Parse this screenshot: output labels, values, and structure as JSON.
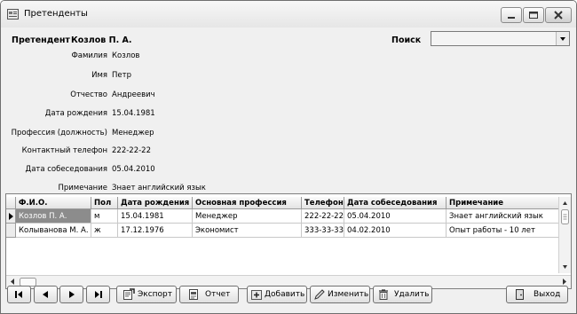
{
  "window": {
    "title": "Претенденты"
  },
  "header": {
    "label": "Претендент",
    "name": "Козлов П. А.",
    "search_label": "Поиск",
    "search_value": ""
  },
  "fields": [
    {
      "label": "Фамилия",
      "value": "Козлов"
    },
    {
      "label": "Имя",
      "value": "Петр"
    },
    {
      "label": "Отчество",
      "value": "Андреевич"
    },
    {
      "label": "Дата рождения",
      "value": "15.04.1981"
    },
    {
      "label": "Профессия (должность)",
      "value": "Менеджер"
    },
    {
      "label": "Контактный телефон",
      "value": "222-22-22"
    },
    {
      "label": "Дата собеседования",
      "value": "05.04.2010"
    },
    {
      "label": "Примечание",
      "value": "Знает английский язык"
    }
  ],
  "grid": {
    "columns": [
      "Ф.И.О.",
      "Пол",
      "Дата рождения",
      "Основная профессия",
      "Телефон",
      "Дата собеседования",
      "Примечание"
    ],
    "rows": [
      [
        "Козлов П. А.",
        "м",
        "15.04.1981",
        "Менеджер",
        "222-22-22",
        "05.04.2010",
        "Знает английский язык"
      ],
      [
        "Колыванова М. А.",
        "ж",
        "17.12.1976",
        "Экономист",
        "333-33-33",
        "04.02.2010",
        "Опыт работы - 10 лет"
      ]
    ],
    "selected_row": 0
  },
  "toolbar": {
    "export_label": "Экспорт",
    "report_label": "Отчет",
    "add_label": "Добавить",
    "edit_label": "Изменить",
    "delete_label": "Удалить",
    "exit_label": "Выход"
  },
  "colors": {
    "selection": "#8c8c8c",
    "window_bg": "#f0f0f0",
    "border": "#7f7f7f"
  }
}
